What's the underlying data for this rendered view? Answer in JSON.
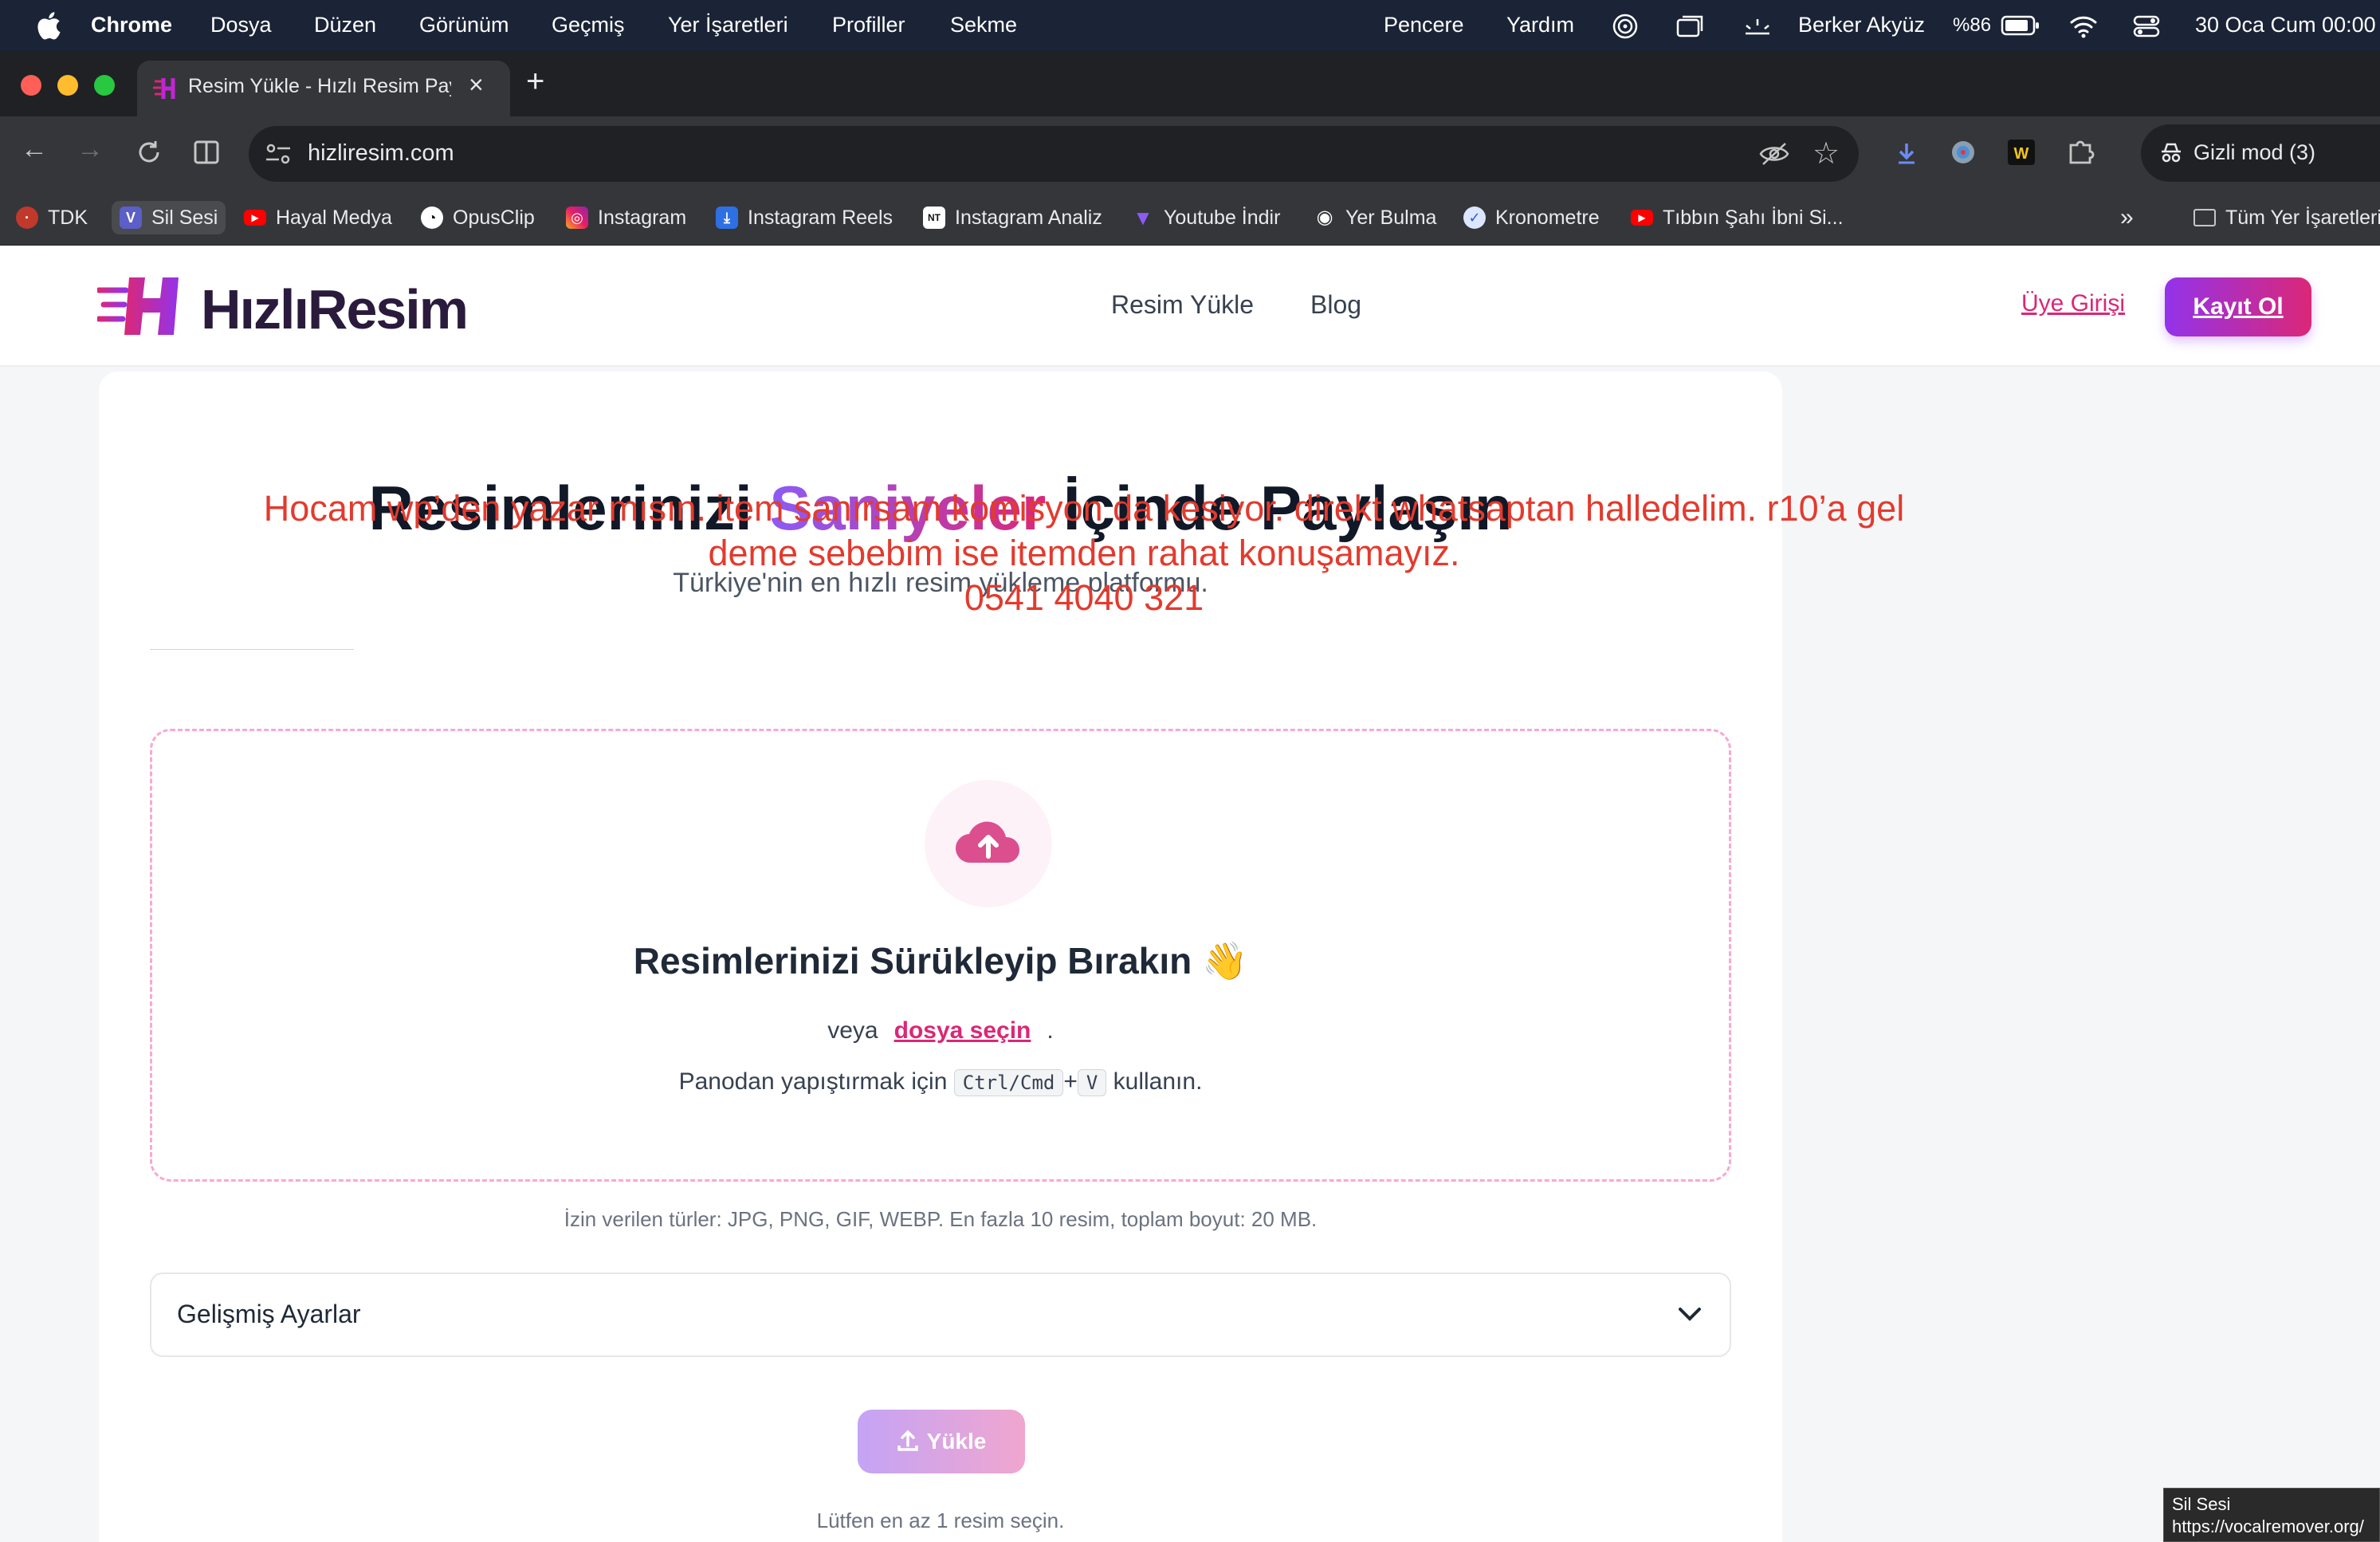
{
  "menubar": {
    "app": "Chrome",
    "items": [
      "Dosya",
      "Düzen",
      "Görünüm",
      "Geçmiş",
      "Yer İşaretleri",
      "Profiller",
      "Sekme",
      "Pencere",
      "Yardım"
    ],
    "user": "Berker Akyüz",
    "battery": "%86",
    "datetime": "30 Oca Cum  00:00"
  },
  "browser": {
    "tab_title": "Resim Yükle - Hızlı Resim Paylaşım",
    "url": "hizliresim.com",
    "incognito_label": "Gizli mod (3)",
    "bookmarks": [
      "TDK",
      "Sil Sesi",
      "Hayal Medya",
      "OpusClip",
      "Instagram",
      "Instagram Reels",
      "Instagram Analiz",
      "Youtube İndir",
      "Yer Bulma",
      "Kronometre",
      "Tıbbın Şahı İbni Si..."
    ],
    "all_bookmarks": "Tüm Yer İşaretleri"
  },
  "site": {
    "logo": "HızlıResim",
    "nav": [
      "Resim Yükle",
      "Blog"
    ],
    "login": "Üye Girişi",
    "signup": "Kayıt Ol"
  },
  "hero": {
    "part1": "Resimlerinizi ",
    "accent": "Saniyeler",
    "part2": " İçinde Paylaşın",
    "subtitle": "Türkiye'nin en hızlı resim yükleme platformu."
  },
  "overlay": {
    "line1": "Hocam wp’den yazar mısın. item sanırsam komisyon da kesiyor. direkt whatsaptan halledelim. r10’a gel",
    "line2": "deme sebebim ise itemden rahat konuşamayız.",
    "line3": "0541 4040 321"
  },
  "dropzone": {
    "title": "Resimlerinizi Sürükleyip Bırakın 👋",
    "or": "veya",
    "choose": "dosya seçin",
    "period": ".",
    "paste_prefix": "Panodan yapıştırmak için",
    "key1": "Ctrl/Cmd",
    "plus": "+",
    "key2": "V",
    "paste_suffix": "kullanın."
  },
  "allowed": "İzin verilen türler: JPG, PNG, GIF, WEBP. En fazla 10 resim, toplam boyut: 20 MB.",
  "advanced": "Gelişmiş Ayarlar",
  "upload_button": "Yükle",
  "hint": "Lütfen en az 1 resim seçin.",
  "tooltip": {
    "title": "Sil Sesi",
    "url": "https://vocalremover.org/"
  },
  "colors": {
    "accent_purple": "#8b5cf6",
    "accent_pink": "#db2777",
    "overlay_red": "#e23b2e"
  }
}
